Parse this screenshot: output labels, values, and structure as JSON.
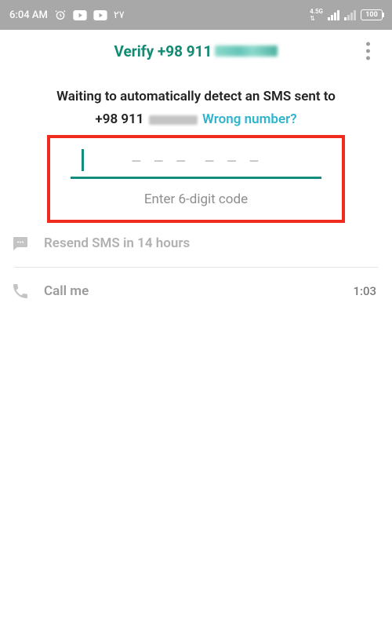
{
  "status": {
    "time": "6:04 AM",
    "extra": "٢٧",
    "network_label": "4.5G",
    "battery": "100"
  },
  "header": {
    "title_prefix": "Verify +98 911"
  },
  "body": {
    "waiting": "Waiting to automatically detect an SMS sent to",
    "phone_prefix": "+98 911",
    "wrong_number": "Wrong number?",
    "hint": "Enter 6-digit code"
  },
  "resend": {
    "label": "Resend SMS in 14 hours"
  },
  "call": {
    "label": "Call me",
    "timer": "1:03"
  }
}
